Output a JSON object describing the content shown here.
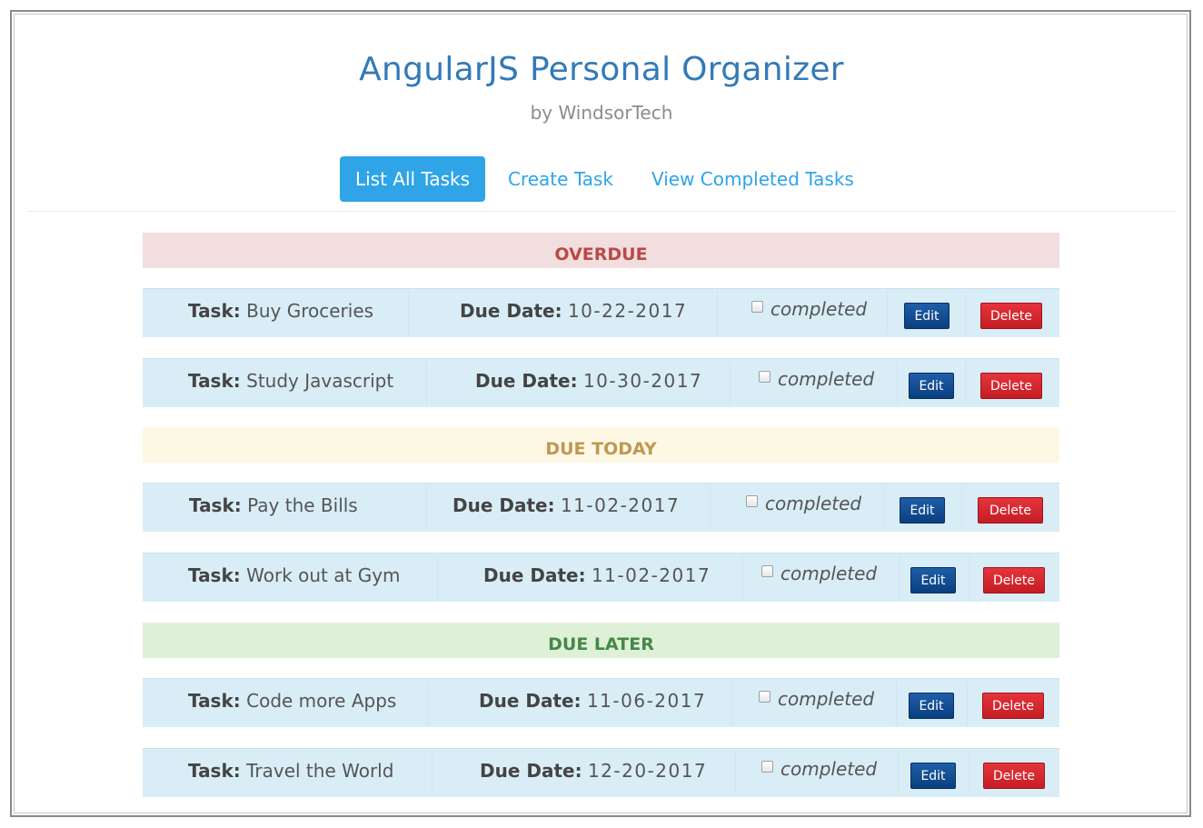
{
  "header": {
    "title": "AngularJS Personal Organizer",
    "subtitle": "by WindsorTech"
  },
  "nav": {
    "tabs": [
      {
        "label": "List All Tasks",
        "active": true
      },
      {
        "label": "Create Task",
        "active": false
      },
      {
        "label": "View Completed Tasks",
        "active": false
      }
    ]
  },
  "labels": {
    "task_prefix": "Task:",
    "due_prefix": "Due Date:",
    "completed": "completed",
    "edit": "Edit",
    "delete": "Delete"
  },
  "colors": {
    "overdue_bg": "#f2dede",
    "overdue_text": "#b94a48",
    "today_bg": "#fcf8e3",
    "today_text": "#c09853",
    "later_bg": "#dff0d8",
    "later_text": "#468847",
    "row_bg": "#d9edf7"
  },
  "sections": [
    {
      "heading": "OVERDUE",
      "tasks": [
        {
          "name": "Buy Groceries",
          "due": "10-22-2017",
          "completed": false
        },
        {
          "name": "Study Javascript",
          "due": "10-30-2017",
          "completed": false
        }
      ]
    },
    {
      "heading": "DUE TODAY",
      "tasks": [
        {
          "name": "Pay the Bills",
          "due": "11-02-2017",
          "completed": false
        },
        {
          "name": "Work out at Gym",
          "due": "11-02-2017",
          "completed": false
        }
      ]
    },
    {
      "heading": "DUE LATER",
      "tasks": [
        {
          "name": "Code more Apps",
          "due": "11-06-2017",
          "completed": false
        },
        {
          "name": "Travel the World",
          "due": "12-20-2017",
          "completed": false
        }
      ]
    }
  ]
}
